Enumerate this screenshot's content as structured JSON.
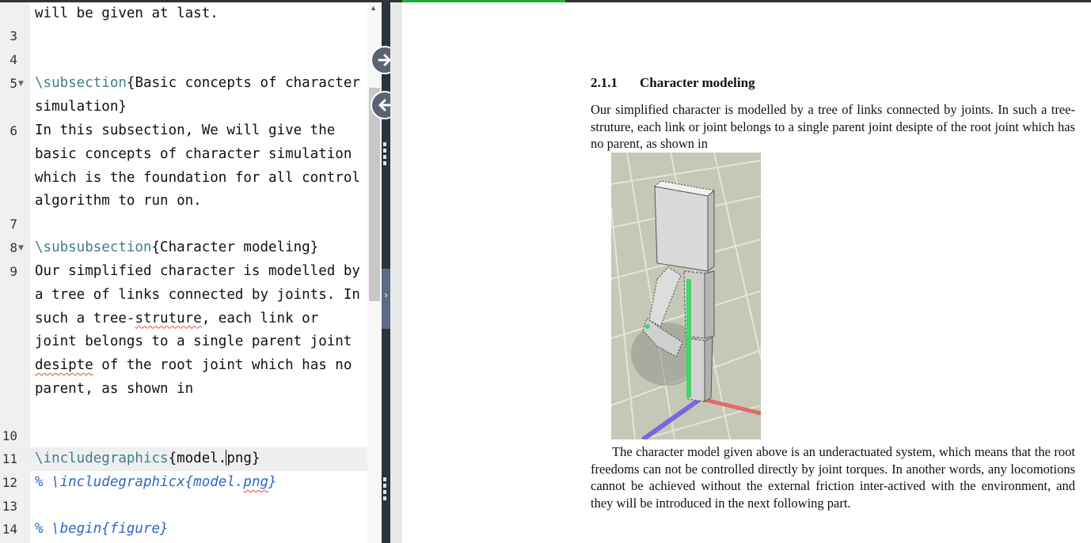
{
  "editor": {
    "lines": [
      {
        "num": "",
        "text": "will be given at last."
      },
      {
        "num": "3",
        "text": ""
      },
      {
        "num": "4",
        "text": ""
      },
      {
        "num": "5",
        "cmd": "\\subsection",
        "arg": "{Basic concepts of character simulation}"
      },
      {
        "num": "6",
        "text": "In this subsection, We will give the basic concepts of character simulation which is the foundation for all control algorithm to run on."
      },
      {
        "num": "7",
        "text": ""
      },
      {
        "num": "8",
        "cmd": "\\subsubsection",
        "arg": "{Character modeling}"
      },
      {
        "num": "9",
        "text_a": "Our simplified character is modelled by a tree of links connected by joints. In such a tree-",
        "text_sq1": "struture",
        "text_b": ", each link or joint belongs to a single parent joint ",
        "text_sq2": "desipte",
        "text_c": " of the root joint which has no parent, as shown in"
      },
      {
        "num": "10",
        "text": ""
      },
      {
        "num": "11",
        "cmd": "\\includegraphics",
        "arg_a": "{model.",
        "arg_b": "png}"
      },
      {
        "num": "12",
        "comment_a": "% \\includegraphicx{model.",
        "comment_sq": "png",
        "comment_b": "}"
      },
      {
        "num": "13",
        "text": ""
      },
      {
        "num": "14",
        "comment": "% \\begin{figure}"
      }
    ]
  },
  "pdf": {
    "section_number": "2.1.1",
    "section_title": "Character modeling",
    "paragraph1": "Our simplified character is modelled by a tree of links connected by joints. In such a tree-struture, each link or joint belongs to a single parent joint desipte of the root joint which has no parent, as shown in",
    "paragraph2": "The character model given above is an underactuated system, which means that the root freedoms can not be controlled directly by joint torques. In another words, any locomotions cannot be achieved without the external friction inter-actived with the environment, and they will be introduced in the next following part."
  },
  "colors": {
    "command": "#3f7f8c",
    "comment": "#2f66c8",
    "spell_error": "#e0463b",
    "splitter": "#2c333a",
    "progress": "#1fae3d"
  },
  "icons": {
    "sync_to_pdf": "arrow-right-icon",
    "sync_to_code": "arrow-left-icon",
    "collapse": "chevron-right-icon",
    "fold": "triangle-down-icon"
  }
}
